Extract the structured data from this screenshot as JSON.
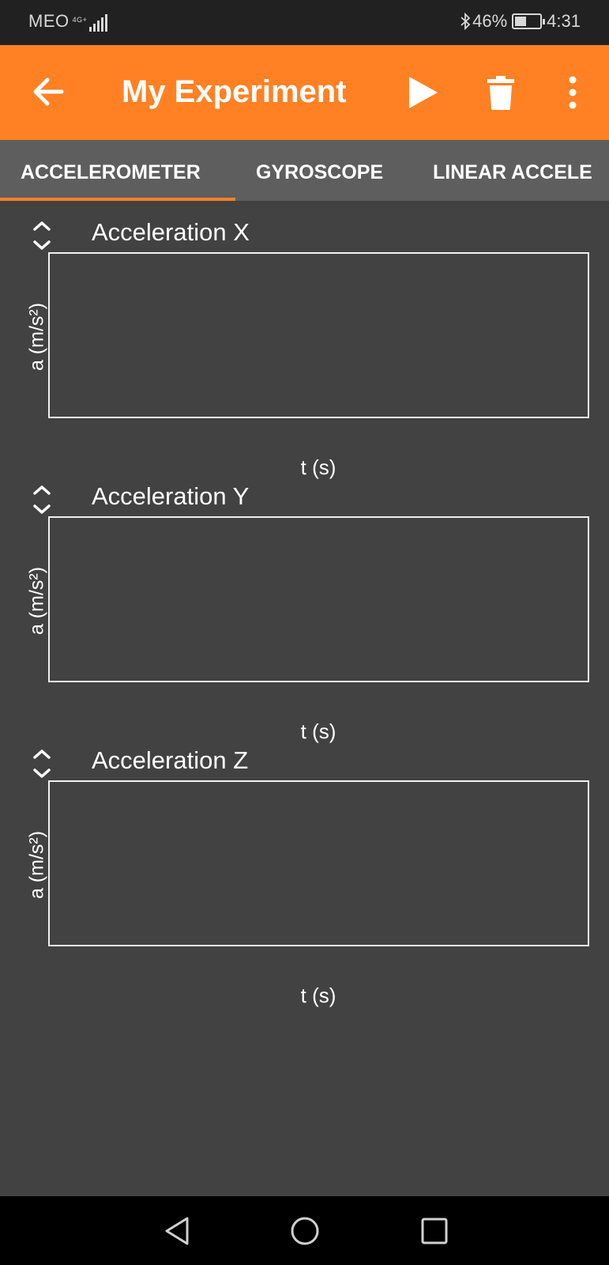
{
  "status_bar": {
    "carrier": "MEO",
    "network": "4G+",
    "battery_percent": "46%",
    "battery_level": 0.46,
    "time": "4:31"
  },
  "app_bar": {
    "title": "My Experiment",
    "background_color": "#ff8124",
    "icons": [
      "arrow-back-icon",
      "play-icon",
      "trash-icon",
      "more-vert-icon"
    ]
  },
  "tabs": [
    {
      "label": "ACCELEROMETER",
      "selected": true
    },
    {
      "label": "GYROSCOPE",
      "selected": false
    },
    {
      "label": "LINEAR ACCELE",
      "selected": false
    }
  ],
  "graphs": [
    {
      "title": "Acceleration X",
      "ylabel": "a (m/s²)",
      "xlabel": "t (s)"
    },
    {
      "title": "Acceleration Y",
      "ylabel": "a (m/s²)",
      "xlabel": "t (s)"
    },
    {
      "title": "Acceleration Z",
      "ylabel": "a (m/s²)",
      "xlabel": "t (s)"
    }
  ],
  "nav_bar": {
    "icons": [
      "nav-back-icon",
      "nav-home-icon",
      "nav-recents-icon"
    ]
  }
}
